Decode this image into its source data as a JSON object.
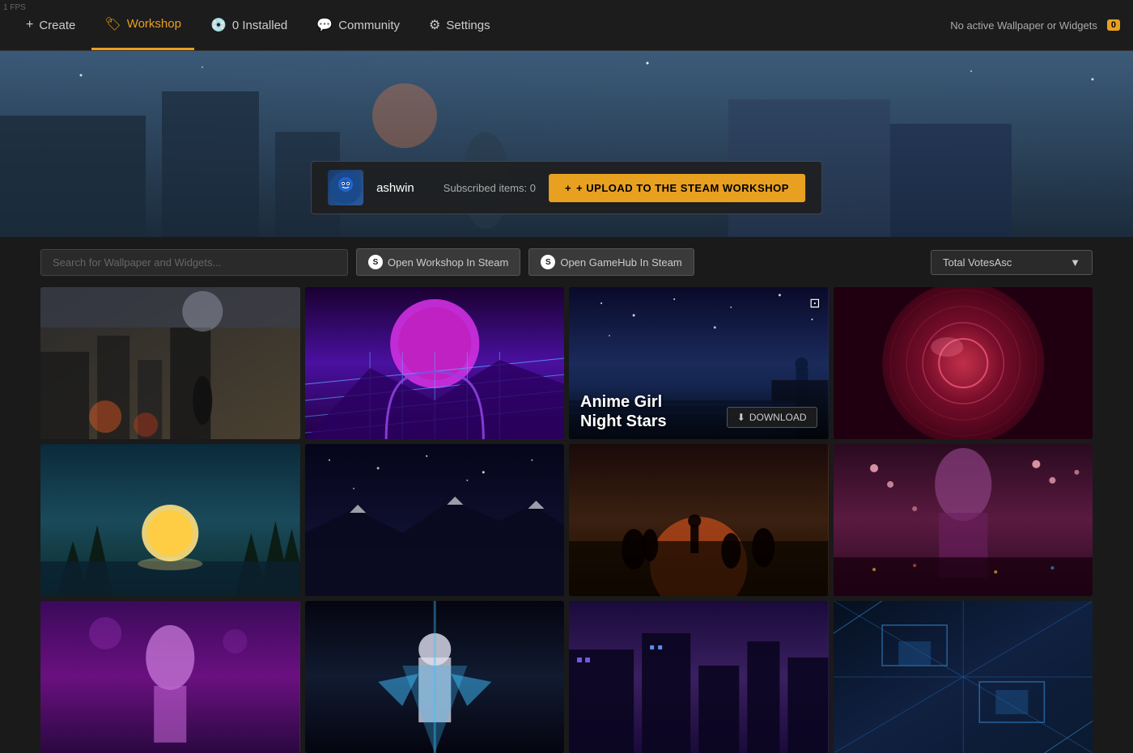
{
  "fps": "1 FPS",
  "nav": {
    "create_label": "Create",
    "workshop_label": "Workshop",
    "installed_label": "0 Installed",
    "community_label": "Community",
    "settings_label": "Settings",
    "active_tab": "workshop",
    "status_text": "No active Wallpaper or Widgets",
    "status_badge": "0"
  },
  "hero": {
    "profile": {
      "username": "ashwin",
      "subscribed_text": "Subscribed items: 0",
      "upload_btn": "+ UPLOAD TO THE STEAM WORKSHOP"
    }
  },
  "toolbar": {
    "search_placeholder": "Search for Wallpaper and Widgets...",
    "open_workshop_btn": "Open Workshop In Steam",
    "open_gamehub_btn": "Open GameHub In Steam",
    "sort_label": "Total VotesAsc",
    "sort_arrow": "▼"
  },
  "grid": {
    "items": [
      {
        "id": 1,
        "title": "",
        "theme": "wp-1",
        "has_info": false
      },
      {
        "id": 2,
        "title": "",
        "theme": "wp-2",
        "has_info": false
      },
      {
        "id": 3,
        "title": "Anime Girl Night Stars",
        "theme": "wp-3",
        "has_info": true,
        "download_btn": "DOWNLOAD",
        "has_external": true
      },
      {
        "id": 4,
        "title": "",
        "theme": "wp-4",
        "has_info": false
      },
      {
        "id": 5,
        "title": "",
        "theme": "wp-5",
        "has_info": false
      },
      {
        "id": 6,
        "title": "",
        "theme": "wp-6",
        "has_info": false
      },
      {
        "id": 7,
        "title": "",
        "theme": "wp-7",
        "has_info": false
      },
      {
        "id": 8,
        "title": "",
        "theme": "wp-8",
        "has_info": false
      },
      {
        "id": 9,
        "title": "",
        "theme": "wp-9",
        "has_info": false
      },
      {
        "id": 10,
        "title": "",
        "theme": "wp-10",
        "has_info": false
      },
      {
        "id": 11,
        "title": "",
        "theme": "wp-11",
        "has_info": false
      },
      {
        "id": 12,
        "title": "",
        "theme": "wp-12",
        "has_info": false
      }
    ]
  },
  "icons": {
    "create": "+",
    "workshop": "🏷",
    "installed": "💿",
    "community": "💬",
    "settings": "⚙",
    "upload": "+",
    "download": "⬇",
    "external": "↗",
    "chevron": "▼",
    "steam": "S"
  }
}
